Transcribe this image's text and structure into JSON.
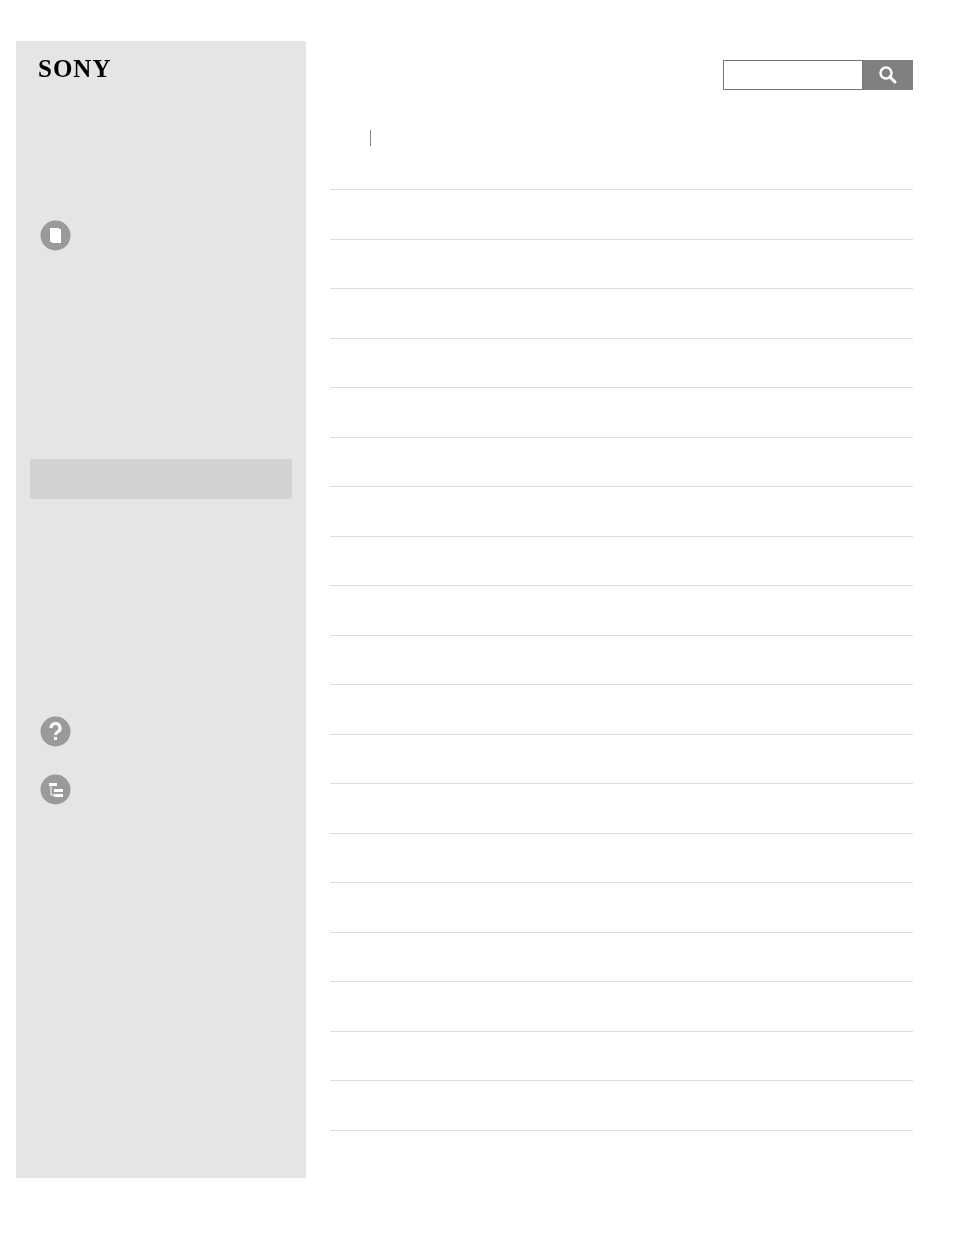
{
  "logo": "SONY"
}
